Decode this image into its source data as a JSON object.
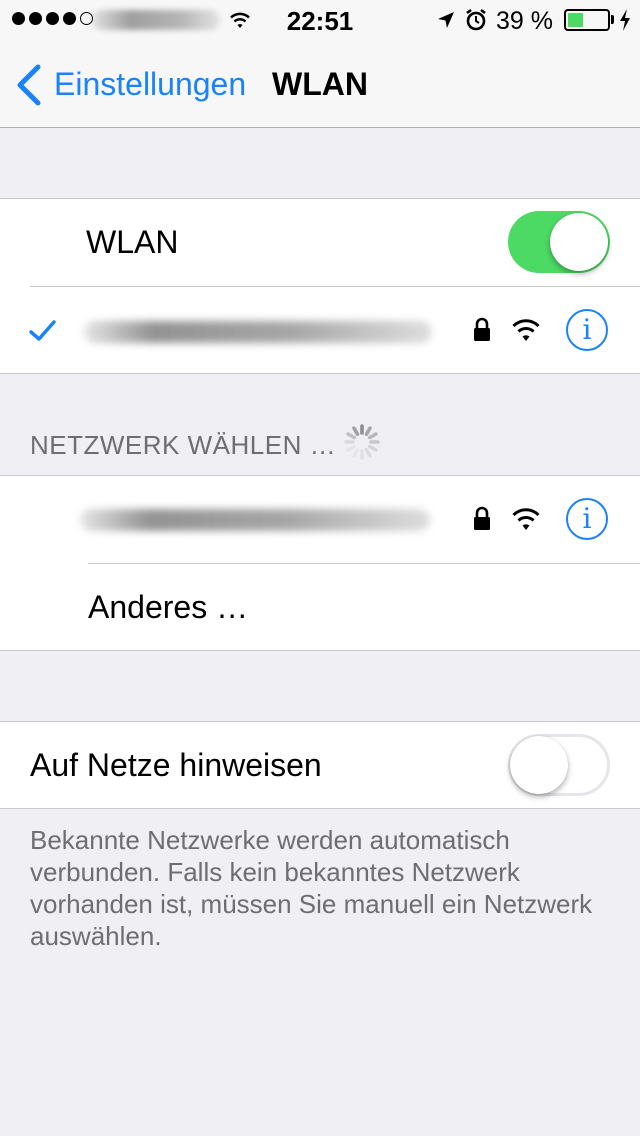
{
  "status_bar": {
    "time": "22:51",
    "battery_percent": "39 %",
    "battery_level": 0.39,
    "signal_bars": 4,
    "signal_total": 5,
    "icons": [
      "wifi-icon",
      "location-arrow-icon",
      "alarm-icon",
      "charging-bolt-icon"
    ]
  },
  "nav": {
    "back_label": "Einstellungen",
    "title": "WLAN"
  },
  "wlan": {
    "label": "WLAN",
    "enabled": true
  },
  "networks": {
    "header": "NETZWERK WÄHLEN …",
    "other_label": "Anderes …"
  },
  "ask_to_join": {
    "label": "Auf Netze hinweisen",
    "enabled": false,
    "footer": "Bekannte Netzwerke werden automatisch verbunden. Falls kein bekanntes Netzwerk vorhanden ist, müssen Sie manuell ein Netzwerk auswählen."
  },
  "colors": {
    "accent": "#1a82fb",
    "switch_on": "#4cd964",
    "background": "#efeff4",
    "secondary_text": "#6d6d72"
  }
}
